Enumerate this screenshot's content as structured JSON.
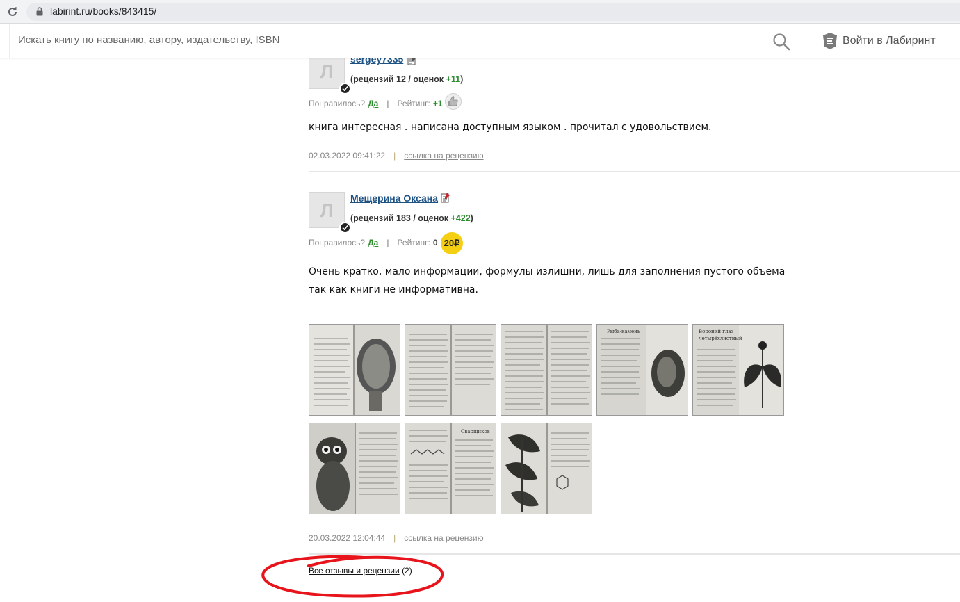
{
  "browser": {
    "url": "labirint.ru/books/843415/"
  },
  "header": {
    "search_placeholder": "Искать книгу по названию, автору, издательству, ISBN",
    "login_label": "Войти в Лабиринт"
  },
  "reviews": [
    {
      "avatar_letter": "Л",
      "author": "sergey7335",
      "stats_prefix": "(рецензий",
      "reviews_count": "12",
      "stats_mid": "/ оценок",
      "score": "+11",
      "stats_suffix": ")",
      "liked_label": "Понравилось?",
      "yes_label": "Да",
      "rating_label": "Рейтинг:",
      "rating_value": "+1",
      "text": "книга интересная . написана доступным языком . прочитал с удовольствием.",
      "date": "02.03.2022 09:41:22",
      "link_label": "ссылка на рецензию"
    },
    {
      "avatar_letter": "Л",
      "author": "Мещерина Оксана",
      "stats_prefix": "(рецензий",
      "reviews_count": "183",
      "stats_mid": "/ оценок",
      "score": "+422",
      "stats_suffix": ")",
      "liked_label": "Понравилось?",
      "yes_label": "Да",
      "rating_label": "Рейтинг:",
      "rating_value": "0",
      "coin_label": "20₽",
      "text": "Очень кратко, мало информации, формулы излишни, лишь для заполнения пустого объема так как книги не информативна.",
      "date": "20.03.2022 12:04:44",
      "link_label": "ссылка на рецензию"
    }
  ],
  "photos": [
    "page-photo-mushroom",
    "page-photo-text",
    "page-photo-text",
    "page-photo-fish-drawing",
    "page-photo-plant-drawing",
    "page-photo-loris-drawing",
    "page-photo-formula",
    "page-photo-leaf-drawing"
  ],
  "footer": {
    "all_reviews_label": "Все отзывы и рецензии",
    "all_reviews_count": "(2)"
  },
  "colors": {
    "link_blue": "#1c5183",
    "positive_green": "#2e8b2e",
    "coin_yellow": "#f5cf12",
    "annotation_red": "#e8141c"
  }
}
